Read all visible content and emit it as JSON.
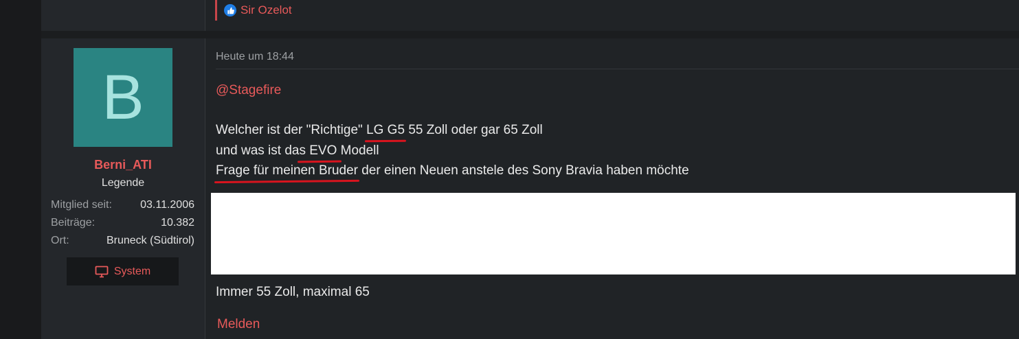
{
  "previous_post": {
    "reaction_icon": "thumbs-up-icon",
    "reaction_user": "Sir Ozelot"
  },
  "post": {
    "author": {
      "avatar_letter": "B",
      "avatar_color": "#2a8482",
      "username": "Berni_ATI",
      "title": "Legende",
      "stats": [
        {
          "label": "Mitglied seit:",
          "value": "03.11.2006"
        },
        {
          "label": "Beiträge:",
          "value": "10.382"
        },
        {
          "label": "Ort:",
          "value": "Bruneck (Südtirol)"
        }
      ],
      "system_button": "System"
    },
    "date": "Heute um 18:44",
    "mention": "@Stagefire",
    "quote": {
      "line1": {
        "a": "Welcher ist der \"Richtige\" ",
        "u": "LG G5",
        "b": " 55 Zoll oder gar 65 Zoll"
      },
      "line2": {
        "a": "und was ist da",
        "u": "s EVO ",
        "b": "Modell"
      },
      "line3": {
        "u": "Frage für meinen Bruder",
        "b": " der einen Neuen anstele des Sony Bravia haben möchte"
      }
    },
    "reply": "Immer 55 Zoll, maximal 65",
    "report": "Melden"
  },
  "colors": {
    "accent": "#e85a5a",
    "underline": "#d8141e",
    "like_blue": "#1f7ee6"
  }
}
